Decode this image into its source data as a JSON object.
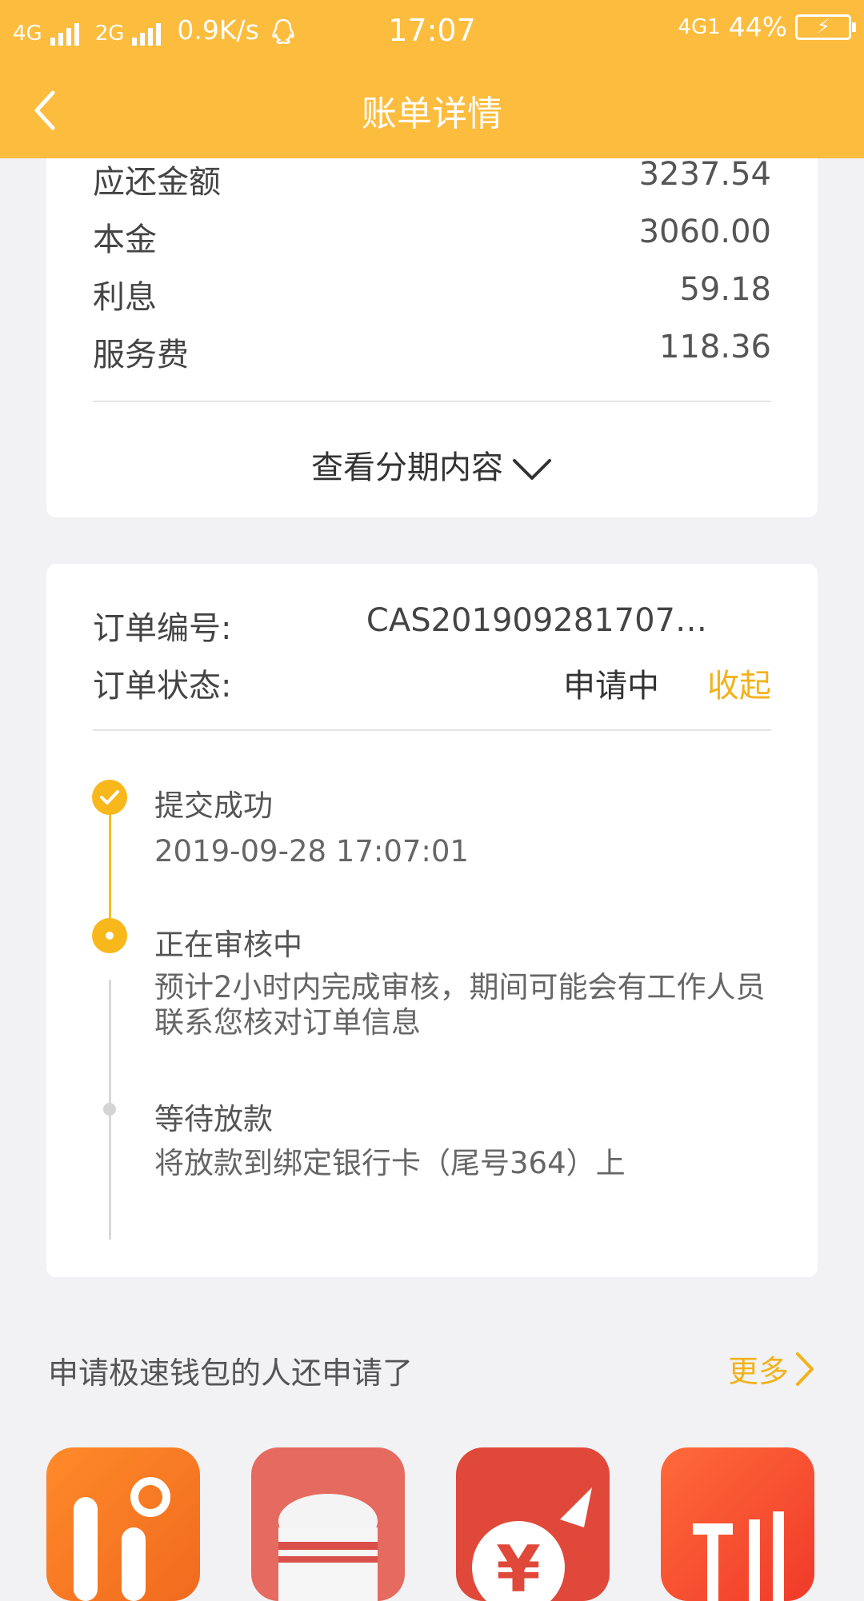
{
  "status_bar": {
    "net1": "4G",
    "net2": "2G",
    "speed": "0.9K/s",
    "time": "17:07",
    "net3": "4G1",
    "battery": "44%"
  },
  "nav": {
    "title": "账单详情"
  },
  "summary": {
    "rows": [
      {
        "label": "应还金额",
        "value": "3237.54"
      },
      {
        "label": "本金",
        "value": "3060.00"
      },
      {
        "label": "利息",
        "value": "59.18"
      },
      {
        "label": "服务费",
        "value": "118.36"
      }
    ],
    "expand_label": "查看分期内容"
  },
  "order": {
    "number_label": "订单编号:",
    "number_value": "CAS201909281707…",
    "status_label": "订单状态:",
    "status_value": "申请中",
    "collapse_label": "收起",
    "timeline": [
      {
        "title": "提交成功",
        "desc": "2019-09-28 17:07:01"
      },
      {
        "title": "正在审核中",
        "desc": "预计2小时内完成审核，期间可能会有工作人员联系您核对订单信息"
      },
      {
        "title": "等待放款",
        "desc": "将放款到绑定银行卡（尾号364）上"
      }
    ]
  },
  "recommend": {
    "title": "申请极速钱包的人还申请了",
    "more_label": "更多"
  },
  "colors": {
    "brand": "#fcbc3e",
    "accent_text": "#f2b21c",
    "timeline_active": "#f8b81c"
  }
}
